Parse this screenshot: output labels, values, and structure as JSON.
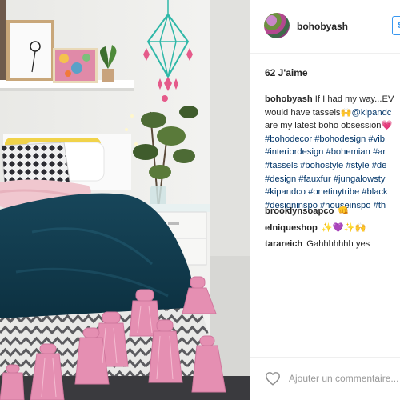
{
  "post": {
    "username": "bohobyash",
    "follow_label": "S'abonner",
    "likes": "62 J'aime",
    "caption": {
      "username": "bohobyash",
      "lines": [
        {
          "text": " If I had my way...EV",
          "cls": "plain"
        },
        {
          "text": "would have tassels🙌@kipandc",
          "cls": "mixed"
        },
        {
          "text": "are my latest boho obsession💗",
          "cls": "plain"
        },
        {
          "text": "#bohodecor #bohodesign #vib",
          "cls": "tag"
        },
        {
          "text": "#interiordesign #bohemian #ar",
          "cls": "tag"
        },
        {
          "text": "#tassels #bohostyle #style #de",
          "cls": "tag"
        },
        {
          "text": "#design #fauxfur #jungalowsty",
          "cls": "tag"
        },
        {
          "text": "#kipandco #onetinytribe #black",
          "cls": "tag"
        },
        {
          "text": "#designinspo #houseinspo #th",
          "cls": "tag"
        }
      ]
    },
    "comments": [
      {
        "username": "brooklynsoapco",
        "text": "👊"
      },
      {
        "username": "elniqueshop",
        "text": "✨💜✨🙌"
      },
      {
        "username": "tarareich",
        "text": "Gahhhhhhh yes"
      }
    ],
    "comment_placeholder": "Ajouter un commentaire..."
  },
  "icons": {
    "like": "heart-outline-icon"
  },
  "colors": {
    "link": "#003569",
    "follow": "#3897f0",
    "text": "#262626",
    "placeholder": "#999999"
  }
}
